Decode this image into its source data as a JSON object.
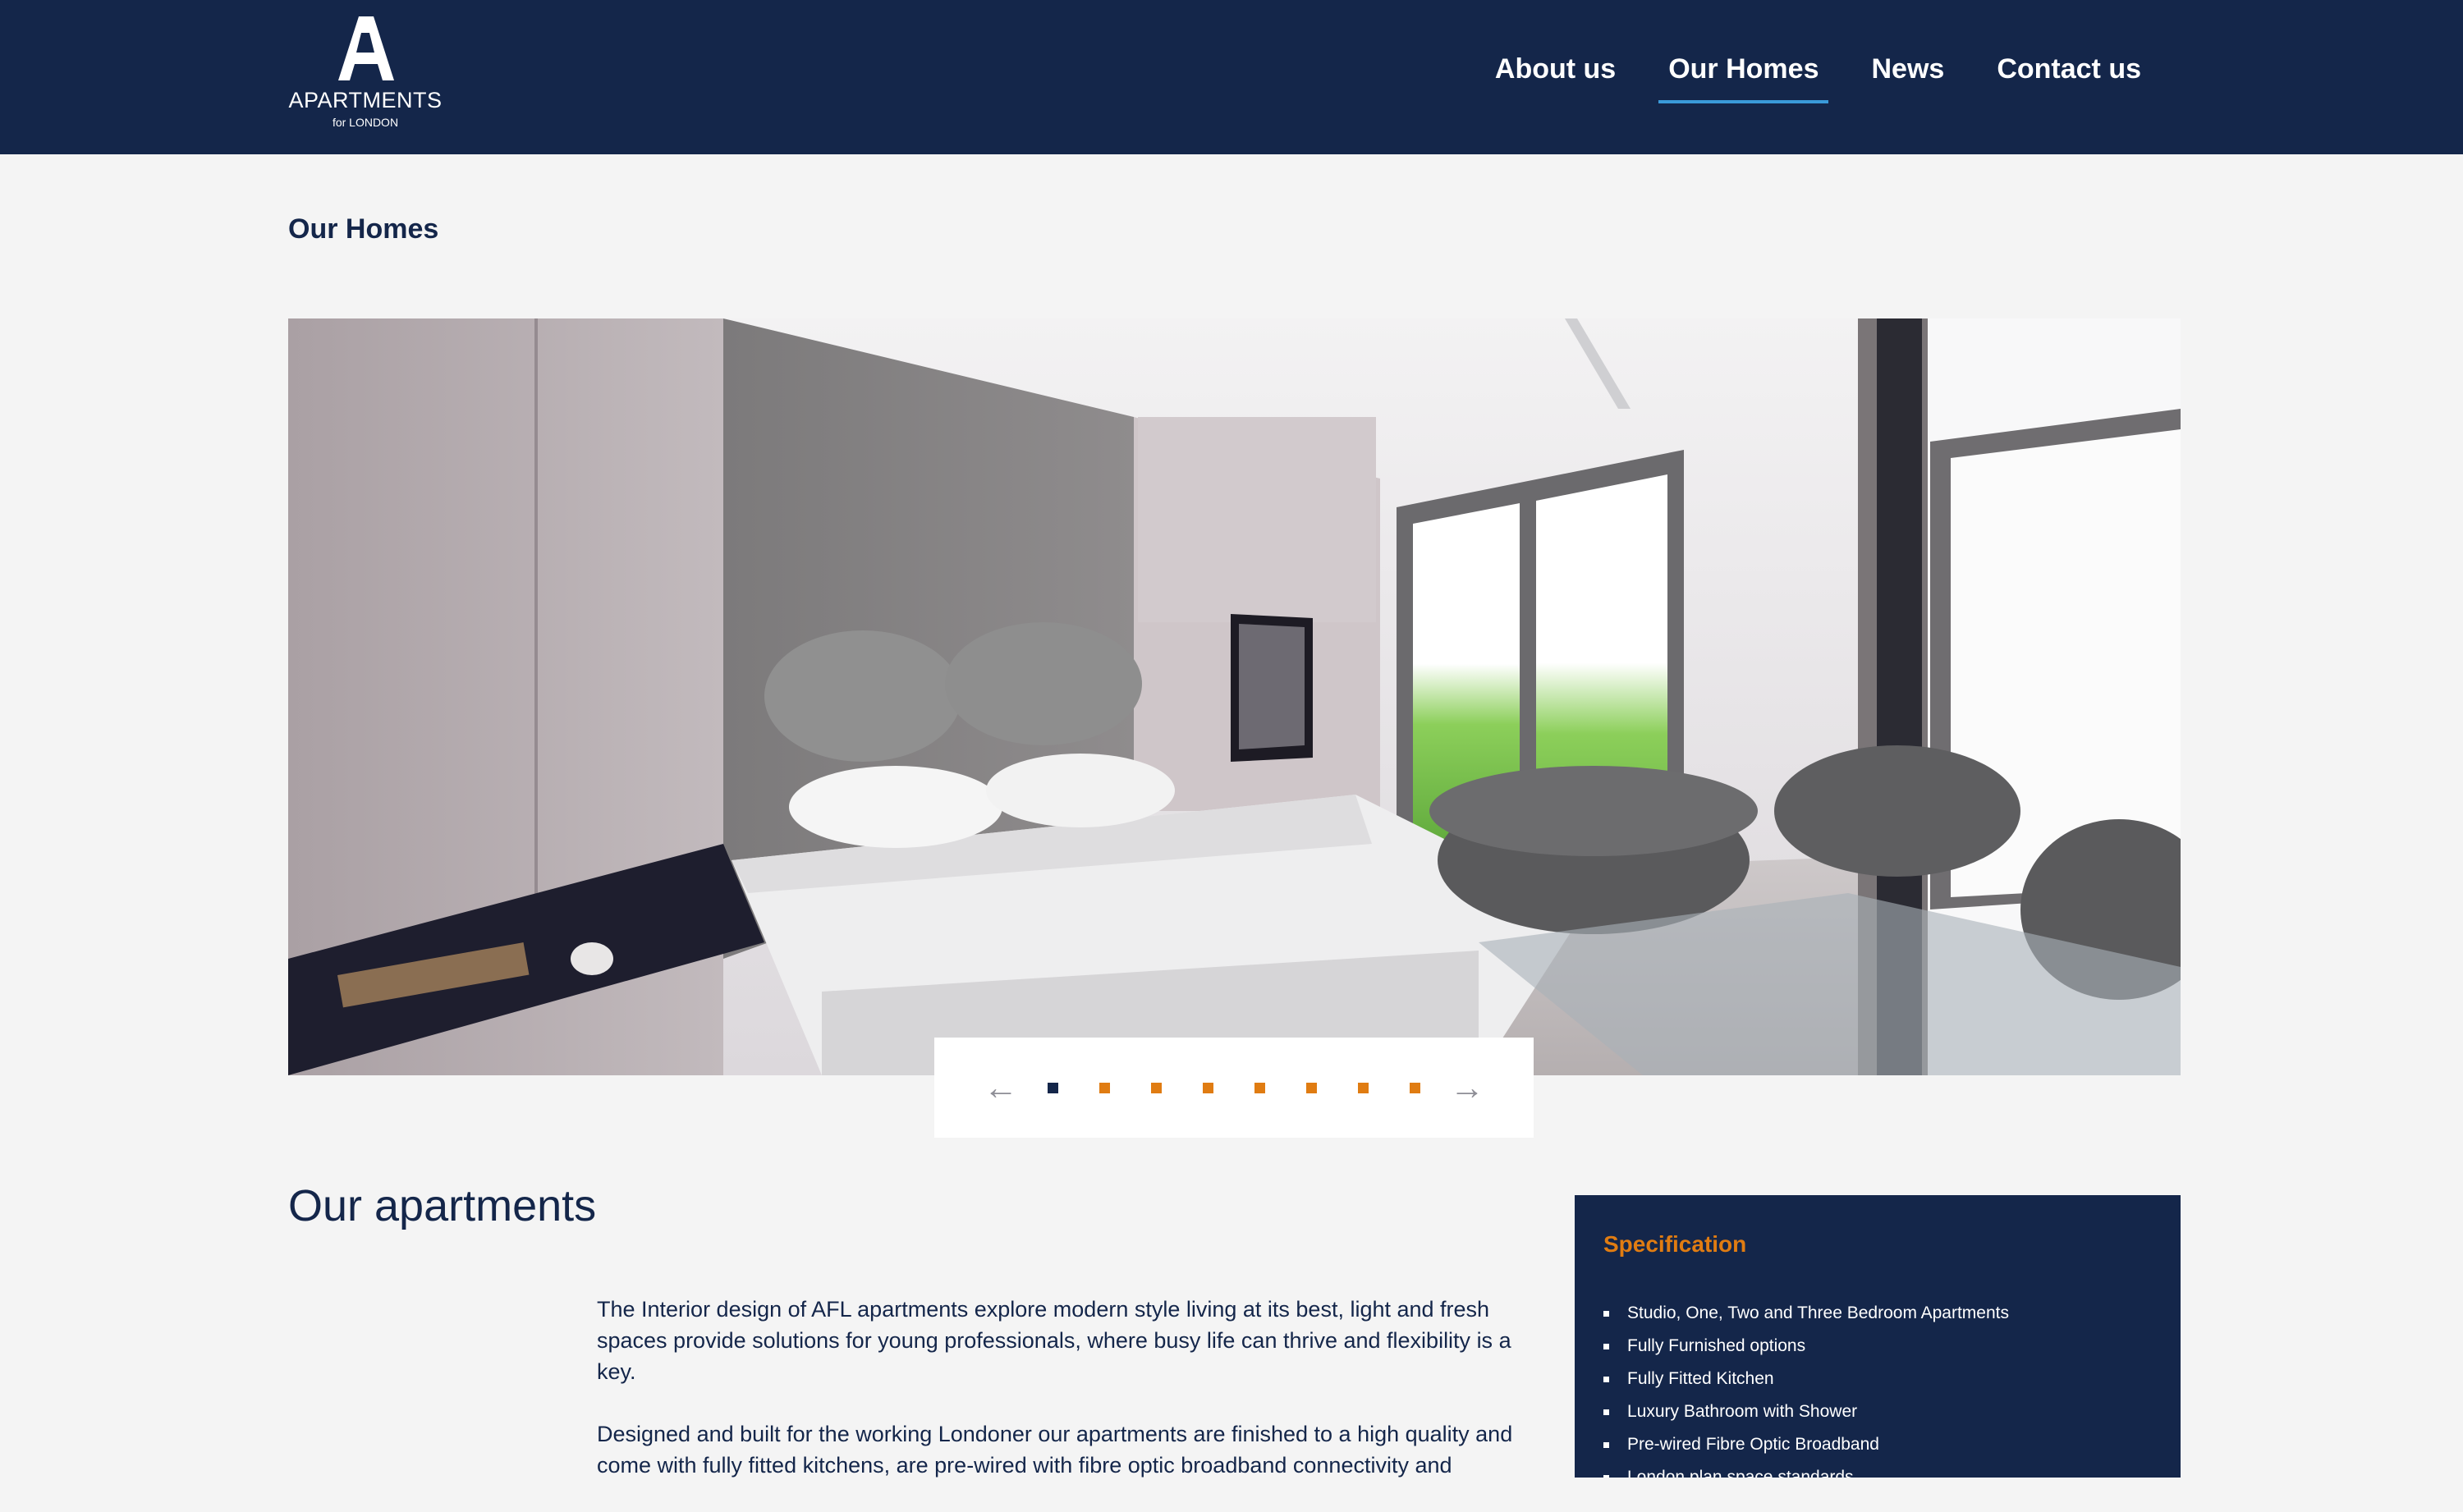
{
  "header": {
    "logo": {
      "name": "APARTMENTS",
      "sub": "for LONDON"
    },
    "nav": [
      {
        "label": "About us",
        "active": false
      },
      {
        "label": "Our Homes",
        "active": true
      },
      {
        "label": "News",
        "active": false
      },
      {
        "label": "Contact us",
        "active": false
      }
    ]
  },
  "page": {
    "title": "Our Homes"
  },
  "slider": {
    "prev_label": "←",
    "next_label": "→",
    "slide_count": 8,
    "active_index": 0
  },
  "apartments": {
    "heading": "Our apartments",
    "paragraphs": [
      "The Interior design of AFL apartments explore modern style living at its best, light and fresh spaces provide solutions for young professionals, where busy life can thrive and flexibility is a key.",
      "Designed and built for the working Londoner our apartments are finished to a high quality and come with fully fitted kitchens, are pre-wired with fibre optic broadband connectivity and"
    ]
  },
  "specification": {
    "title": "Specification",
    "items": [
      "Studio, One, Two and Three Bedroom Apartments",
      "Fully Furnished options",
      "Fully Fitted Kitchen",
      "Luxury Bathroom with Shower",
      "Pre-wired Fibre Optic Broadband",
      "London plan space standards"
    ]
  },
  "colors": {
    "navy": "#14264a",
    "accent_orange": "#e07c12",
    "nav_underline": "#3a9ad9",
    "page_bg": "#f4f4f4"
  }
}
